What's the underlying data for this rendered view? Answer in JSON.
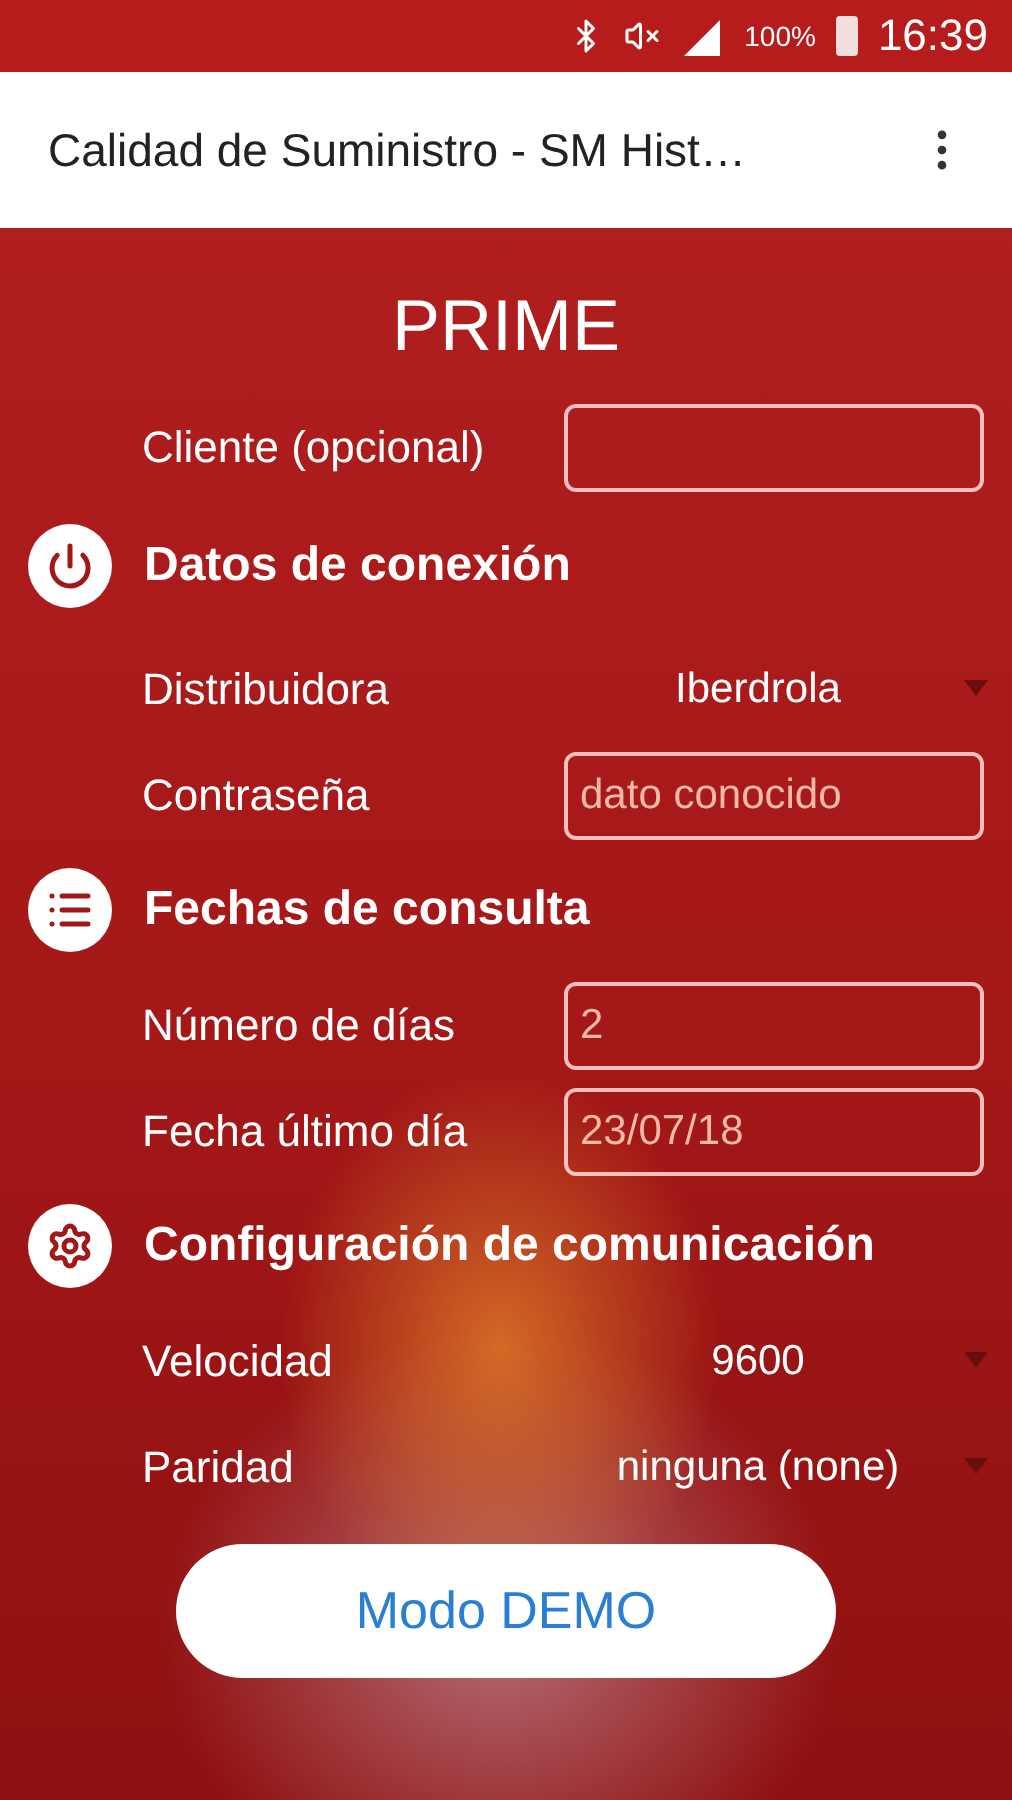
{
  "status_bar": {
    "battery": "100%",
    "time": "16:39"
  },
  "app_bar": {
    "title": "Calidad de Suministro - SM Hist…"
  },
  "title": "PRIME",
  "client": {
    "label": "Cliente (opcional)"
  },
  "sections": [
    {
      "title": "Datos de conexión",
      "rows": [
        {
          "kind": "select",
          "label": "Distribuidora",
          "value": "Iberdrola"
        },
        {
          "kind": "field",
          "label": "Contraseña",
          "placeholder": "dato conocido"
        }
      ]
    },
    {
      "title": "Fechas de consulta",
      "rows": [
        {
          "kind": "field",
          "label": "Número de días",
          "placeholder": "2"
        },
        {
          "kind": "field",
          "label": "Fecha último día",
          "placeholder": "23/07/18"
        }
      ]
    },
    {
      "title": "Configuración de comunicación",
      "rows": [
        {
          "kind": "select",
          "label": "Velocidad",
          "value": "9600"
        },
        {
          "kind": "select",
          "label": "Paridad",
          "value": "ninguna (none)"
        }
      ]
    }
  ],
  "button": "Modo DEMO"
}
